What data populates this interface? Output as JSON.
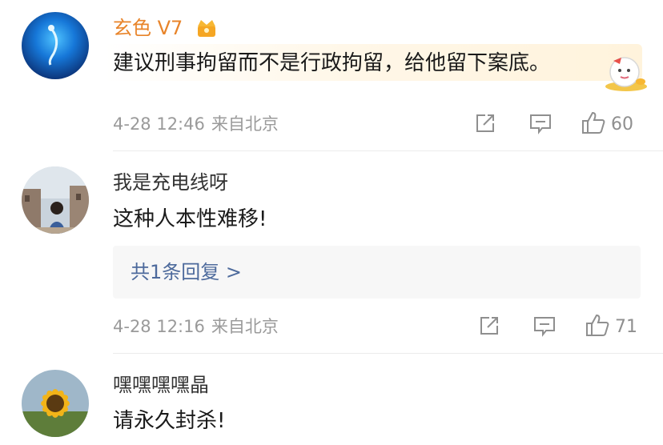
{
  "comments": [
    {
      "username": "玄色 V7",
      "text": "建议刑事拘留而不是行政拘留，给他留下案底。",
      "date": "4-28 12:46",
      "location": "来自北京",
      "likes": "60"
    },
    {
      "username": "我是充电线呀",
      "text": "这种人本性难移!",
      "date": "4-28 12:16",
      "location": "来自北京",
      "likes": "71",
      "reply_label": "共1条回复 >"
    },
    {
      "username": "嘿嘿嘿嘿晶",
      "text": "请永久封杀!"
    }
  ],
  "colors": {
    "vip_name": "#e8842a",
    "reply_link": "#4d6a9c",
    "meta": "#9a9a9a"
  },
  "icons": [
    "crown-badge-icon",
    "share-icon",
    "comment-icon",
    "thumbs-up-icon",
    "mascot-sticker-icon"
  ]
}
